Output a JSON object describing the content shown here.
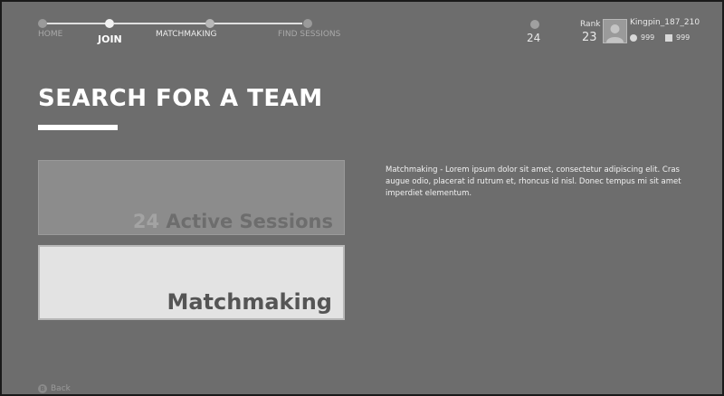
{
  "nav": {
    "steps": [
      {
        "label": "HOME"
      },
      {
        "label": "JOIN"
      },
      {
        "label": "MATCHMAKING"
      },
      {
        "label": "FIND SESSIONS"
      }
    ]
  },
  "player": {
    "rank_icon_value": "24",
    "rank_label": "Rank",
    "rank_value": "23",
    "gamertag": "Kingpin_187_210",
    "coins": "999",
    "gems": "999"
  },
  "page": {
    "title": "SEARCH FOR A TEAM"
  },
  "tiles": {
    "sessions_count": "24",
    "sessions_label": "Active Sessions",
    "matchmaking_label": "Matchmaking"
  },
  "description": "Matchmaking - Lorem ipsum dolor sit amet, consectetur adipiscing elit. Cras augue odio, placerat id rutrum et, rhoncus id nisl. Donec tempus mi sit amet imperdiet elementum.",
  "footer": {
    "back_icon_letter": "B",
    "back_label": "Back"
  },
  "colors": {
    "background": "#6d6d6d",
    "nav_active": "#e0e0e0",
    "nav_inactive": "#9a9a9a",
    "tile_selected": "#e3e3e3",
    "tile_unselected": "#8c8c8c"
  }
}
